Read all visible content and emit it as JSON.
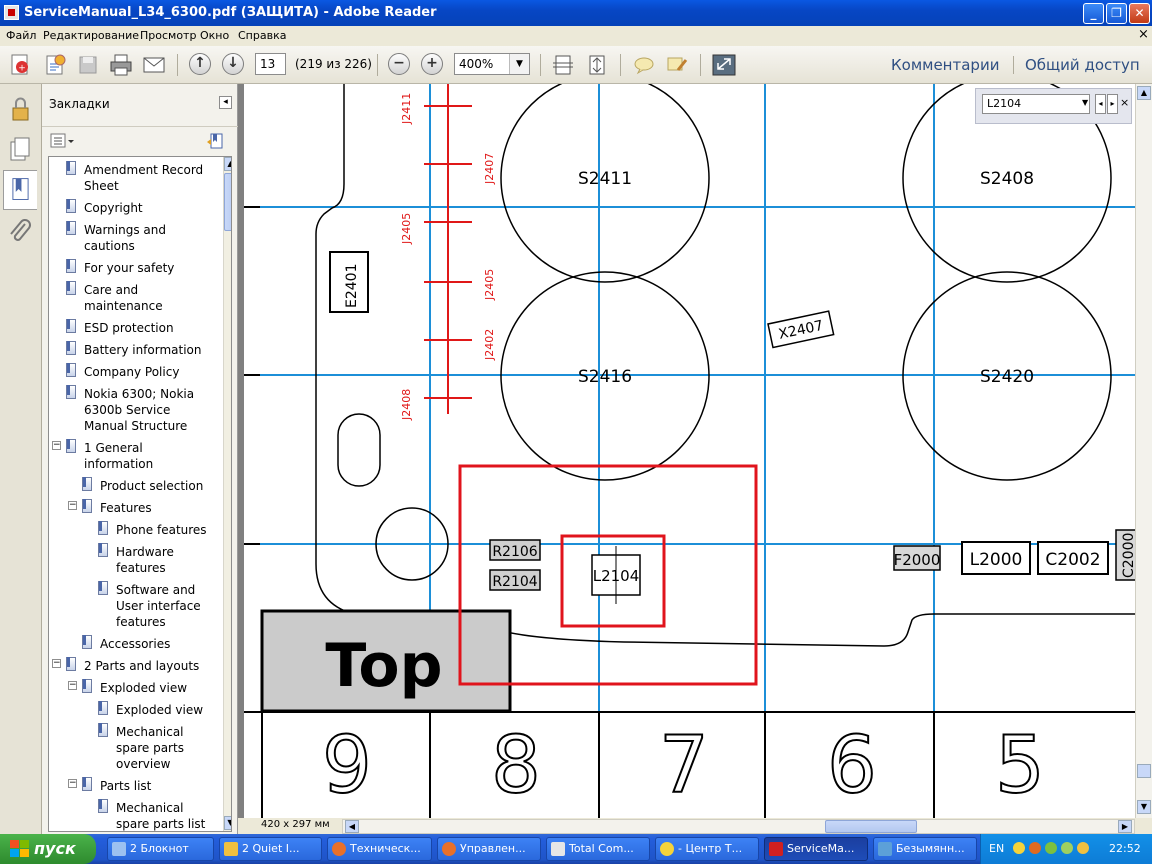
{
  "window": {
    "title": "ServiceManual_L34_6300.pdf (ЗАЩИТА) - Adobe Reader",
    "minimize": "_",
    "restore": "❐",
    "close": "✕"
  },
  "menu": [
    "Файл",
    "Редактирование",
    "Просмотр",
    "Окно",
    "Справка"
  ],
  "menu_close": "×",
  "toolbar": {
    "page_number": "13",
    "page_count": "(219 из 226)",
    "zoom": "400%",
    "comments_label": "Комментарии",
    "share_label": "Общий доступ"
  },
  "bookmarks": {
    "title": "Закладки",
    "collapse": "◂",
    "items": [
      {
        "label": "Amendment Record Sheet",
        "line1": "Amendment Record",
        "line2": "Sheet",
        "level": 1
      },
      {
        "label": "Copyright",
        "line1": "Copyright",
        "level": 1
      },
      {
        "label": "Warnings and cautions",
        "line1": "Warnings and",
        "line2": "cautions",
        "level": 1
      },
      {
        "label": "For your safety",
        "line1": "For your safety",
        "level": 1
      },
      {
        "label": "Care and maintenance",
        "line1": "Care and",
        "line2": "maintenance",
        "level": 1
      },
      {
        "label": "ESD protection",
        "line1": "ESD protection",
        "level": 1
      },
      {
        "label": "Battery information",
        "line1": "Battery information",
        "level": 1
      },
      {
        "label": "Company Policy",
        "line1": "Company Policy",
        "level": 1
      },
      {
        "label": "Nokia 6300; Nokia 6300b Service Manual Structure",
        "line1": "Nokia 6300; Nokia",
        "line2": "6300b Service",
        "line3": "Manual Structure",
        "level": 1
      },
      {
        "label": "1 General information",
        "line1": "1  General",
        "line2": "information",
        "level": 1
      },
      {
        "label": "Product selection",
        "line1": "Product selection",
        "level": 2
      },
      {
        "label": "Features",
        "line1": "Features",
        "level": 2
      },
      {
        "label": "Phone features",
        "line1": "Phone features",
        "level": 3
      },
      {
        "label": "Hardware features",
        "line1": "Hardware",
        "line2": "features",
        "level": 3
      },
      {
        "label": "Software and User interface features",
        "line1": "Software and",
        "line2": "User interface",
        "line3": "features",
        "level": 3
      },
      {
        "label": "Accessories",
        "line1": "Accessories",
        "level": 2
      },
      {
        "label": "2 Parts and layouts",
        "line1": "2  Parts and layouts",
        "level": 1
      },
      {
        "label": "Exploded view",
        "line1": "Exploded view",
        "level": 2
      },
      {
        "label": "Exploded view",
        "line1": "Exploded view",
        "level": 3
      },
      {
        "label": "Mechanical spare parts overview",
        "line1": "Mechanical",
        "line2": "spare parts",
        "line3": "overview",
        "level": 3
      },
      {
        "label": "Parts list",
        "line1": "Parts list",
        "level": 2
      },
      {
        "label": "Mechanical spare parts list",
        "line1": "Mechanical",
        "line2": "spare parts list",
        "level": 3
      }
    ]
  },
  "find": {
    "value": "L2104"
  },
  "document": {
    "page_size": "420 x 297 мм",
    "components": {
      "s2411": "S2411",
      "s2408": "S2408",
      "s2416": "S2416",
      "s2420": "S2420",
      "e2401": "E2401",
      "x2407": "X2407",
      "r2106": "R2106",
      "r2104": "R2104",
      "l2104": "L2104",
      "f2000": "F2000",
      "l2000": "L2000",
      "c2002": "C2002",
      "c2000": "C2000",
      "j2411": "J2411",
      "j2407": "J2407",
      "j2405a": "J2405",
      "j2405b": "J2405",
      "j2402": "J2402",
      "j2408": "J2408"
    },
    "top_label": "Top",
    "grid_numbers": [
      "9",
      "8",
      "7",
      "6",
      "5"
    ],
    "highlight_color": "#E0141C",
    "grid_color": "#1C8FD8"
  },
  "taskbar": {
    "start": "пуск",
    "tasks": [
      {
        "label": "2 Блокнот",
        "color": "#9CC1F0"
      },
      {
        "label": "2 Quiet I...",
        "color": "#F0C040"
      },
      {
        "label": "Техническ...",
        "color": "#E8702A"
      },
      {
        "label": "Управлен...",
        "color": "#E8702A"
      },
      {
        "label": "Total Com...",
        "color": "#E6E6E6"
      },
      {
        "label": "- Центр Т...",
        "color": "#F5D33A"
      },
      {
        "label": "ServiceMa...",
        "color": "#D02020"
      },
      {
        "label": "Безымянн...",
        "color": "#5CA0D8"
      }
    ],
    "lang": "EN",
    "clock": "22:52"
  }
}
